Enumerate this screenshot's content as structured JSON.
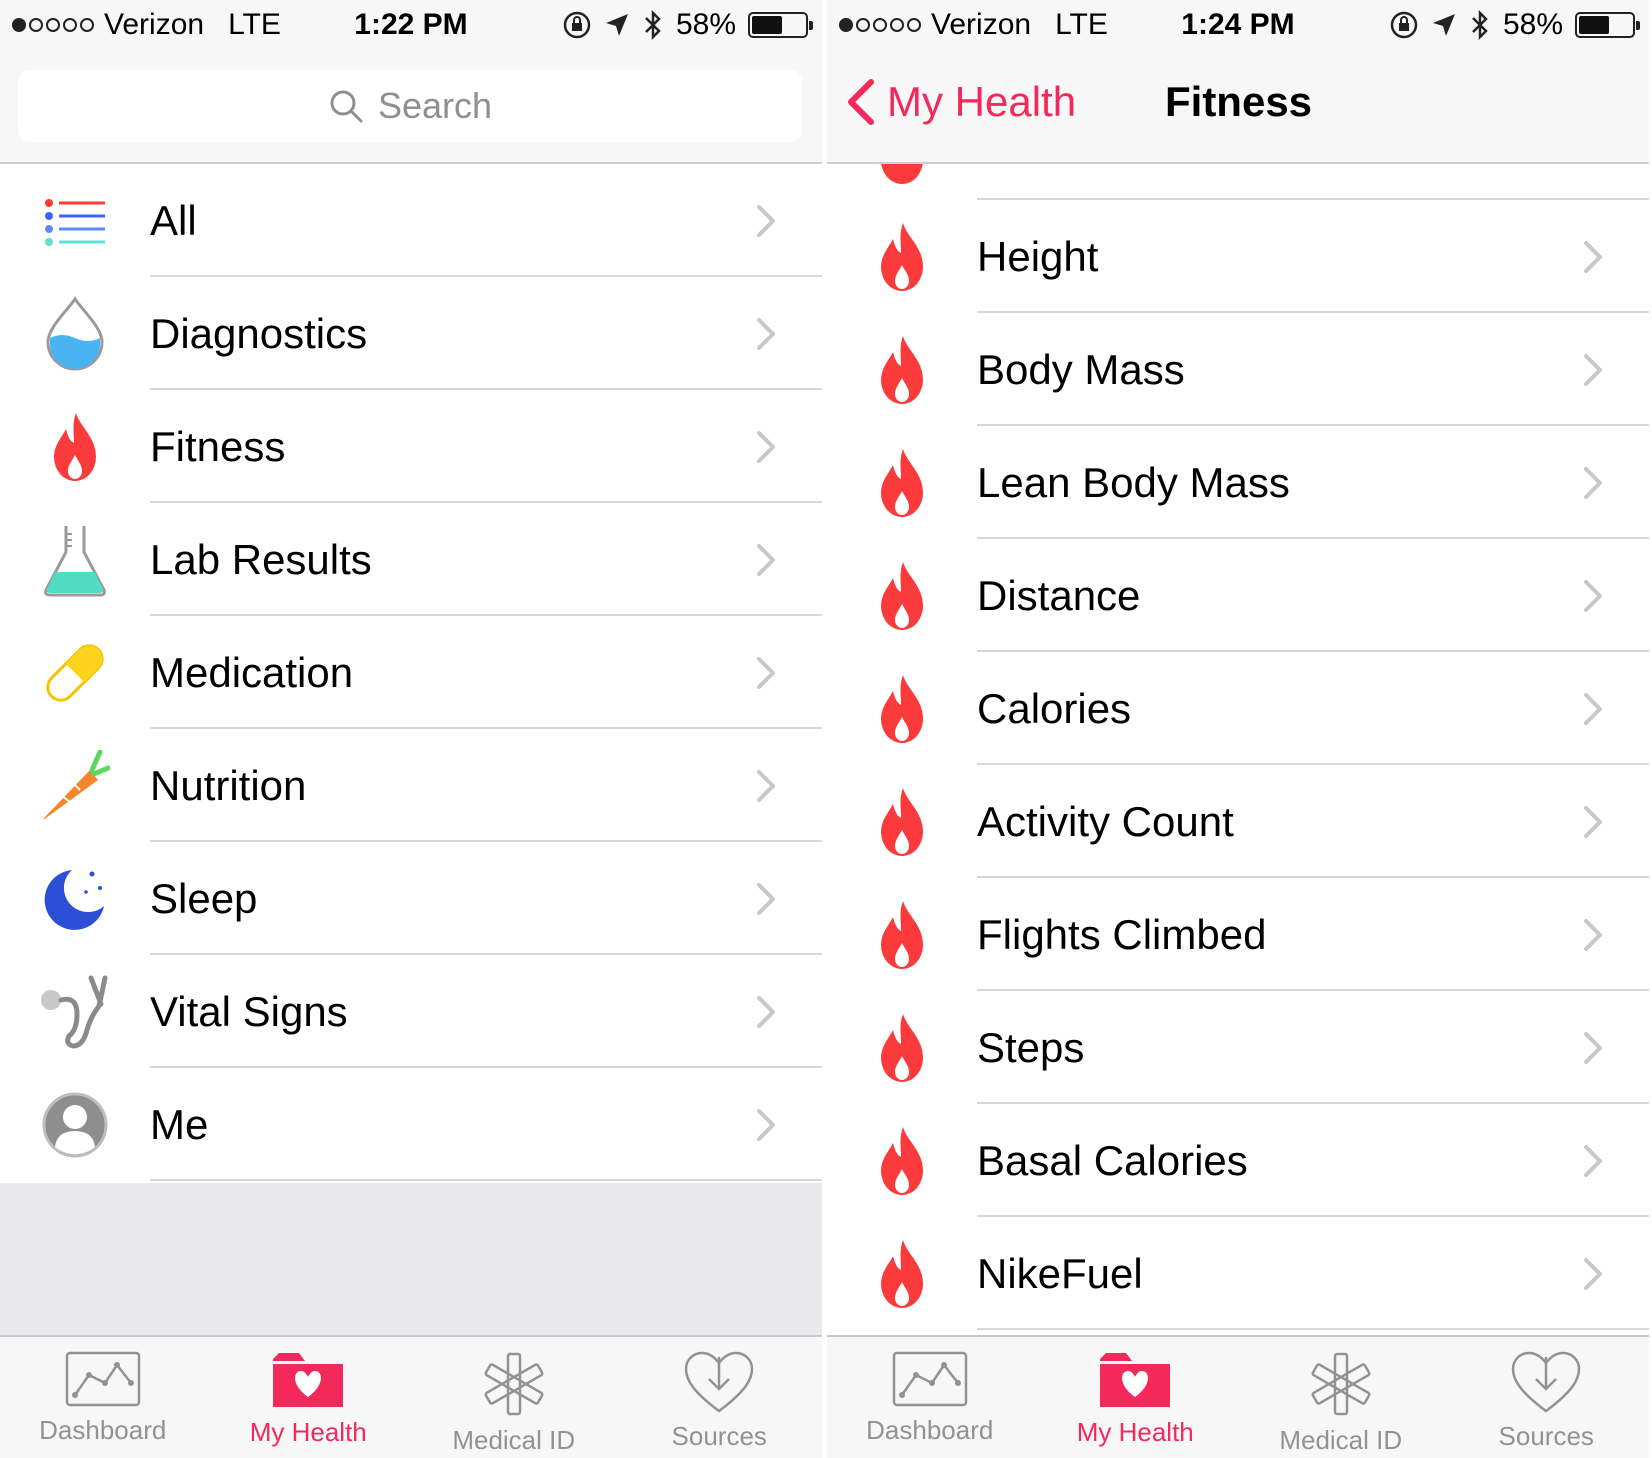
{
  "colors": {
    "accent": "#f2295a",
    "fitness_red": "#fb3b3b",
    "tab_inactive": "#929292",
    "separator": "#d8d8dc"
  },
  "left_screen": {
    "status": {
      "carrier": "Verizon",
      "network": "LTE",
      "time": "1:22 PM",
      "battery": "58%",
      "battery_level": 0.58
    },
    "search": {
      "placeholder": "Search"
    },
    "categories": [
      {
        "label": "All",
        "icon": "list-icon"
      },
      {
        "label": "Diagnostics",
        "icon": "water-drop-icon"
      },
      {
        "label": "Fitness",
        "icon": "flame-icon"
      },
      {
        "label": "Lab Results",
        "icon": "flask-icon"
      },
      {
        "label": "Medication",
        "icon": "pill-icon"
      },
      {
        "label": "Nutrition",
        "icon": "carrot-icon"
      },
      {
        "label": "Sleep",
        "icon": "moon-icon"
      },
      {
        "label": "Vital Signs",
        "icon": "stethoscope-icon"
      },
      {
        "label": "Me",
        "icon": "person-icon"
      }
    ],
    "tabs": [
      {
        "label": "Dashboard",
        "icon": "chart-icon",
        "active": false
      },
      {
        "label": "My Health",
        "icon": "heart-folder-icon",
        "active": true
      },
      {
        "label": "Medical ID",
        "icon": "medical-star-icon",
        "active": false
      },
      {
        "label": "Sources",
        "icon": "download-heart-icon",
        "active": false
      }
    ]
  },
  "right_screen": {
    "status": {
      "carrier": "Verizon",
      "network": "LTE",
      "time": "1:24 PM",
      "battery": "58%",
      "battery_level": 0.58
    },
    "nav": {
      "back_label": "My Health",
      "title": "Fitness"
    },
    "items": [
      {
        "label": "Height",
        "icon": "flame-icon"
      },
      {
        "label": "Body Mass",
        "icon": "flame-icon"
      },
      {
        "label": "Lean Body Mass",
        "icon": "flame-icon"
      },
      {
        "label": "Distance",
        "icon": "flame-icon"
      },
      {
        "label": "Calories",
        "icon": "flame-icon"
      },
      {
        "label": "Activity Count",
        "icon": "flame-icon"
      },
      {
        "label": "Flights Climbed",
        "icon": "flame-icon"
      },
      {
        "label": "Steps",
        "icon": "flame-icon"
      },
      {
        "label": "Basal Calories",
        "icon": "flame-icon"
      },
      {
        "label": "NikeFuel",
        "icon": "flame-icon"
      }
    ],
    "tabs": [
      {
        "label": "Dashboard",
        "icon": "chart-icon",
        "active": false
      },
      {
        "label": "My Health",
        "icon": "heart-folder-icon",
        "active": true
      },
      {
        "label": "Medical ID",
        "icon": "medical-star-icon",
        "active": false
      },
      {
        "label": "Sources",
        "icon": "download-heart-icon",
        "active": false
      }
    ]
  }
}
